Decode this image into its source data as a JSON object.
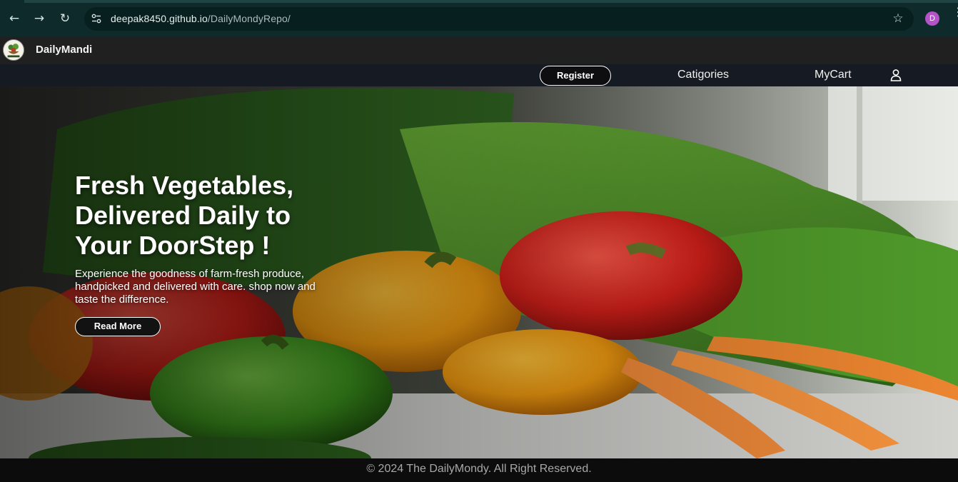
{
  "browser": {
    "url_host": "deepak8450.github.io",
    "url_path": "/DailyMondyRepo/",
    "profile_initial": "D",
    "icons": {
      "back": "back-arrow-icon",
      "forward": "forward-arrow-icon",
      "reload": "reload-icon",
      "site_info": "site-settings-icon",
      "bookmark": "star-icon",
      "menu": "kebab-menu-icon"
    }
  },
  "header": {
    "brand": "DailyMandi",
    "logo": "vegetable-basket-logo"
  },
  "nav": {
    "register": "Register",
    "categories": "Catigories",
    "cart": "MyCart",
    "account_icon": "user-icon"
  },
  "hero": {
    "title_line1": "Fresh Vegetables,",
    "title_line2": "Delivered Daily to",
    "title_line3": "Your DoorStep !",
    "description": "Experience the goodness of farm-fresh produce, handpicked and delivered with care. shop now and taste the difference.",
    "cta": "Read More"
  },
  "footer": {
    "copyright": "© 2024 The DailyMondy. All Right Reserved."
  },
  "colors": {
    "browser_bg": "#0f2a2b",
    "header_bg": "#202020",
    "nav_bg": "#161a22",
    "footer_bg": "#0c0c0c",
    "profile": "#b452c8"
  }
}
